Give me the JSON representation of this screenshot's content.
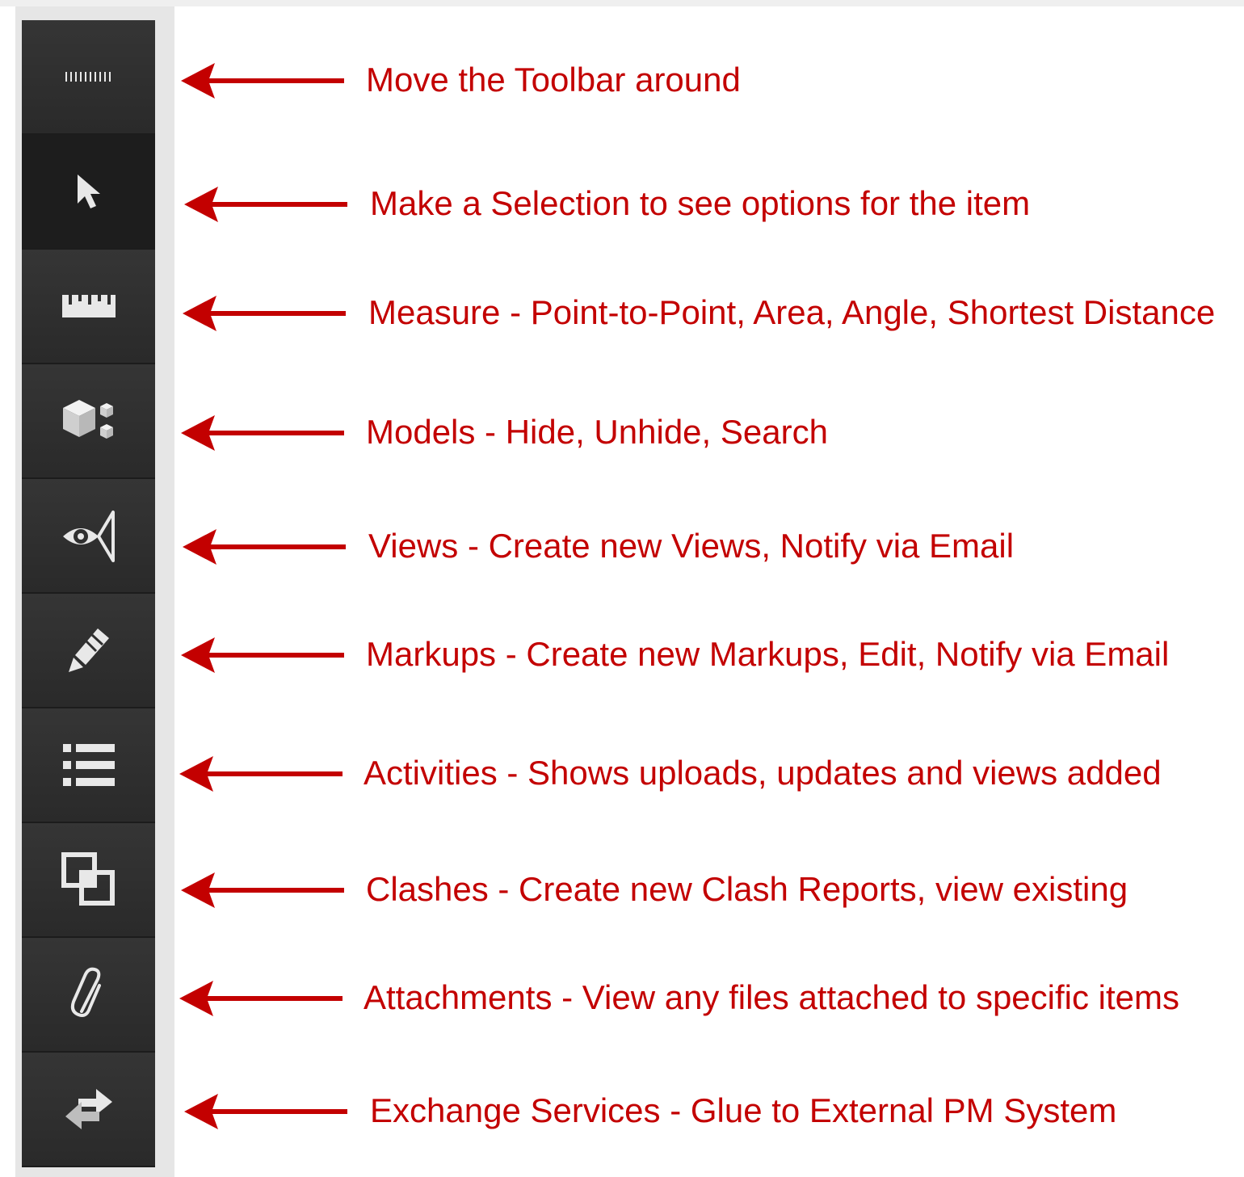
{
  "colors": {
    "annotation": "#c30000",
    "toolbar_bg": "#2b2b2b",
    "toolbar_frame": "#e6e6e6",
    "icon": "#e8e8e8"
  },
  "toolbar": {
    "items": [
      {
        "icon": "grip-handle-icon",
        "annotation": "Move the Toolbar around"
      },
      {
        "icon": "cursor-arrow-icon",
        "annotation": "Make a Selection to see options for the item",
        "active": true
      },
      {
        "icon": "ruler-icon",
        "annotation": "Measure - Point-to-Point, Area, Angle, Shortest Distance"
      },
      {
        "icon": "models-cubes-icon",
        "annotation": "Models - Hide, Unhide, Search"
      },
      {
        "icon": "eye-view-icon",
        "annotation": "Views - Create new Views, Notify via Email"
      },
      {
        "icon": "markup-pencil-icon",
        "annotation": "Markups - Create new Markups, Edit, Notify via Email"
      },
      {
        "icon": "list-icon",
        "annotation": "Activities - Shows uploads, updates and views added"
      },
      {
        "icon": "clash-squares-icon",
        "annotation": "Clashes - Create new Clash Reports, view existing"
      },
      {
        "icon": "paperclip-icon",
        "annotation": "Attachments - View any files attached to specific items"
      },
      {
        "icon": "exchange-arrows-icon",
        "annotation": "Exchange Services - Glue to External PM System"
      }
    ]
  }
}
